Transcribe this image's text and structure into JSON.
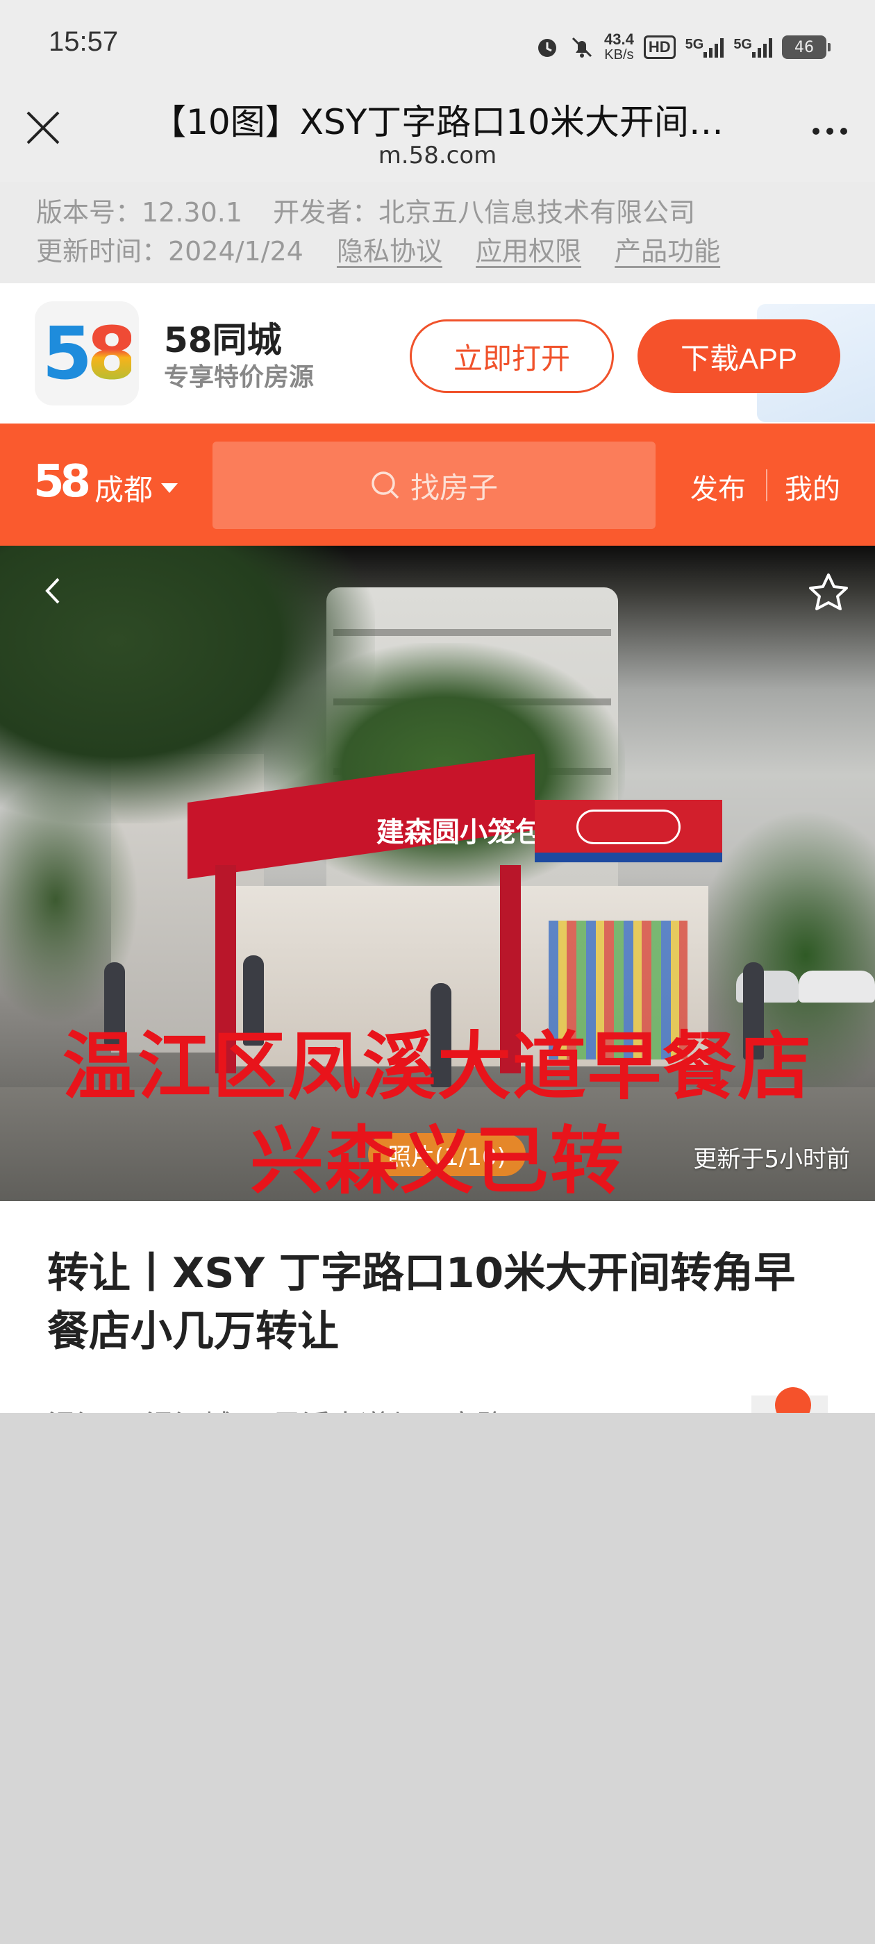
{
  "status_bar": {
    "time": "15:57",
    "net_speed_value": "43.4",
    "net_speed_unit": "KB/s",
    "hd_label": "HD",
    "signal1_label": "5G",
    "signal2_label": "5G",
    "battery": "46"
  },
  "browser": {
    "title": "【10图】XSY丁字路口10米大开间…",
    "url": "m.58.com"
  },
  "app_info": {
    "version": "版本号：12.30.1",
    "developer": "开发者：北京五八信息技术有限公司",
    "updated": "更新时间：2024/1/24",
    "privacy": "隐私协议",
    "permissions": "应用权限",
    "features": "产品功能"
  },
  "promo": {
    "logo_5": "5",
    "logo_8": "8",
    "brand_name": "58同城",
    "slogan": "专享特价房源",
    "open_button": "立即打开",
    "download_button": "下载APP"
  },
  "nav": {
    "logo": "58",
    "city": "成都",
    "search_placeholder": "找房子",
    "publish": "发布",
    "mine": "我的"
  },
  "hero": {
    "shop_sign": "建森圆小笼包",
    "overlay_line1": "温江区凤溪大道早餐店",
    "overlay_line2": "兴森义已转",
    "photo_count": "照片(1/10)",
    "updated": "更新于5小时前"
  },
  "listing": {
    "title": "转让丨XSY 丁字路口10米大开间转角早餐店小几万转让",
    "location": "温江区-温江城区-凤溪大道与丁字路口"
  },
  "colors": {
    "brand_orange": "#fa5a2e",
    "button_orange": "#f5522b",
    "overlay_red": "#e8141b"
  }
}
